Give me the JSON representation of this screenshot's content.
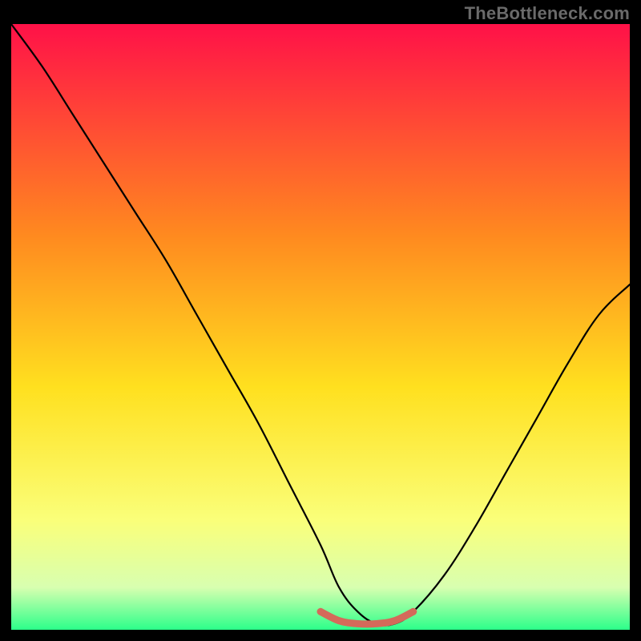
{
  "watermark": "TheBottleneck.com",
  "chart_data": {
    "type": "line",
    "title": "",
    "xlabel": "",
    "ylabel": "",
    "xlim": [
      0,
      100
    ],
    "ylim": [
      0,
      100
    ],
    "grid": false,
    "legend": false,
    "gradient_colors": {
      "top": "#ff1148",
      "upper_mid": "#ff8a1f",
      "mid": "#ffe01f",
      "lower_mid": "#faff7a",
      "lower": "#d8ffb0",
      "bottom": "#2cff8a"
    },
    "series": [
      {
        "name": "bottleneck-curve",
        "color": "#000000",
        "x": [
          0,
          5,
          10,
          15,
          20,
          25,
          30,
          35,
          40,
          45,
          50,
          53,
          56,
          59,
          62,
          65,
          70,
          75,
          80,
          85,
          90,
          95,
          100
        ],
        "values": [
          100,
          93,
          85,
          77,
          69,
          61,
          52,
          43,
          34,
          24,
          14,
          7,
          3,
          1,
          1,
          3,
          9,
          17,
          26,
          35,
          44,
          52,
          57
        ]
      },
      {
        "name": "sweet-spot-marker",
        "color": "#d46a5a",
        "x": [
          50,
          53,
          56,
          59,
          62,
          65
        ],
        "values": [
          3,
          1.5,
          1,
          1,
          1.5,
          3
        ]
      }
    ],
    "annotations": []
  }
}
